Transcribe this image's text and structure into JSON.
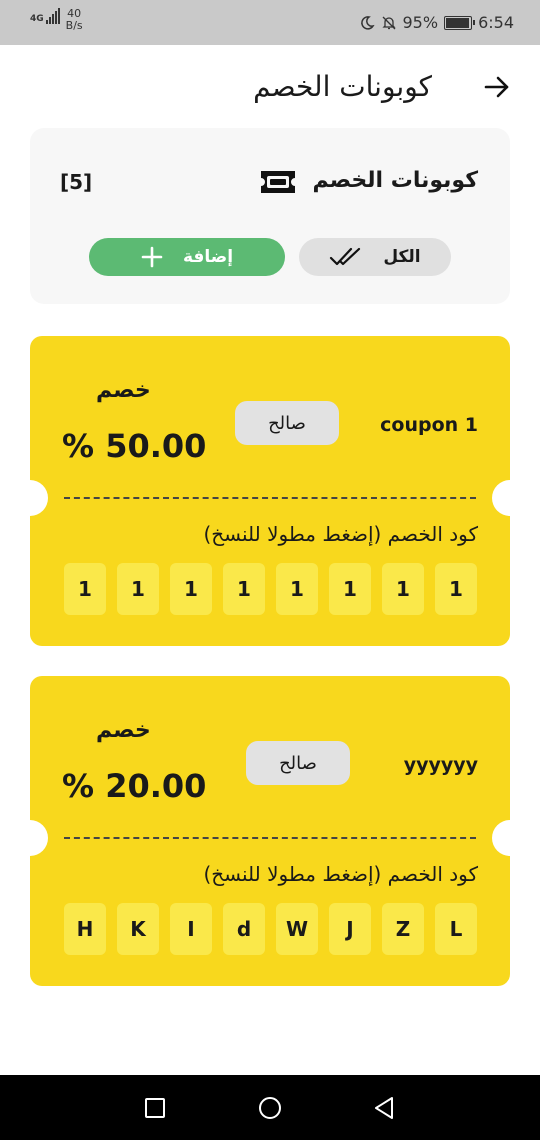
{
  "status_bar": {
    "network": "4G",
    "net_speed_value": "40",
    "net_speed_unit": "B/s",
    "battery_percent": "95%",
    "battery_level": 0.95,
    "time": "6:54",
    "icons": [
      "moon-icon",
      "bell-off-icon",
      "battery-icon",
      "signal-icon"
    ]
  },
  "header": {
    "title": "كوبونات الخصم",
    "back_icon": "arrow-right-icon"
  },
  "summary": {
    "title": "كوبونات الخصم",
    "icon": "ticket-icon",
    "count": "[5]",
    "all_button": {
      "label": "الكل",
      "icon": "double-check-icon"
    },
    "add_button": {
      "label": "إضافة",
      "icon": "plus-icon"
    }
  },
  "coupons": [
    {
      "name": "coupon 1",
      "status": "صالح",
      "discount_label": "خصم",
      "amount": "% 50.00",
      "code_hint": "كود الخصم (إضغط مطولا للنسخ)",
      "code_chars": [
        "1",
        "1",
        "1",
        "1",
        "1",
        "1",
        "1",
        "1"
      ]
    },
    {
      "name": "yyyyyy",
      "status": "صالح",
      "discount_label": "خصم",
      "amount": "% 20.00",
      "code_hint": "كود الخصم (إضغط مطولا للنسخ)",
      "code_chars": [
        "H",
        "K",
        "I",
        "d",
        "W",
        "J",
        "Z",
        "L"
      ]
    }
  ],
  "nav_bar": {
    "buttons": [
      "recents-square-icon",
      "home-circle-icon",
      "back-triangle-icon"
    ]
  },
  "colors": {
    "coupon_bg": "#f8d81d",
    "code_cell_bg": "#fae84a",
    "add_button": "#5cba73",
    "status_bar_bg": "#c9c9c9"
  }
}
